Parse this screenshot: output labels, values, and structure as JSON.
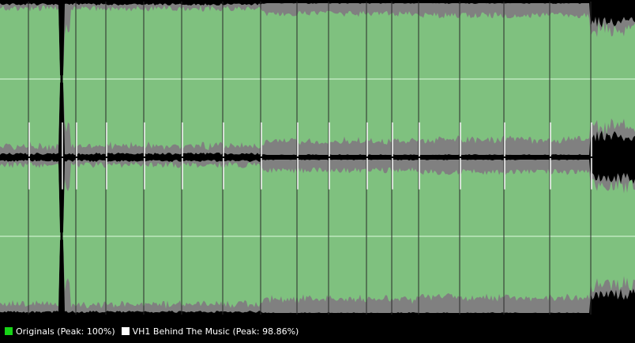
{
  "colors": {
    "originals": "#7fc17f",
    "behind_the_music": "#808080",
    "background": "#000000",
    "center_line": "#c9f0c9",
    "legend_originals_swatch": "#17d317",
    "legend_behind_swatch": "#ffffff"
  },
  "legend": {
    "originals": {
      "label": "Originals (Peak: 100%)"
    },
    "behind_the_music": {
      "label": "VH1 Behind The Music (Peak: 98.86%)"
    }
  }
}
